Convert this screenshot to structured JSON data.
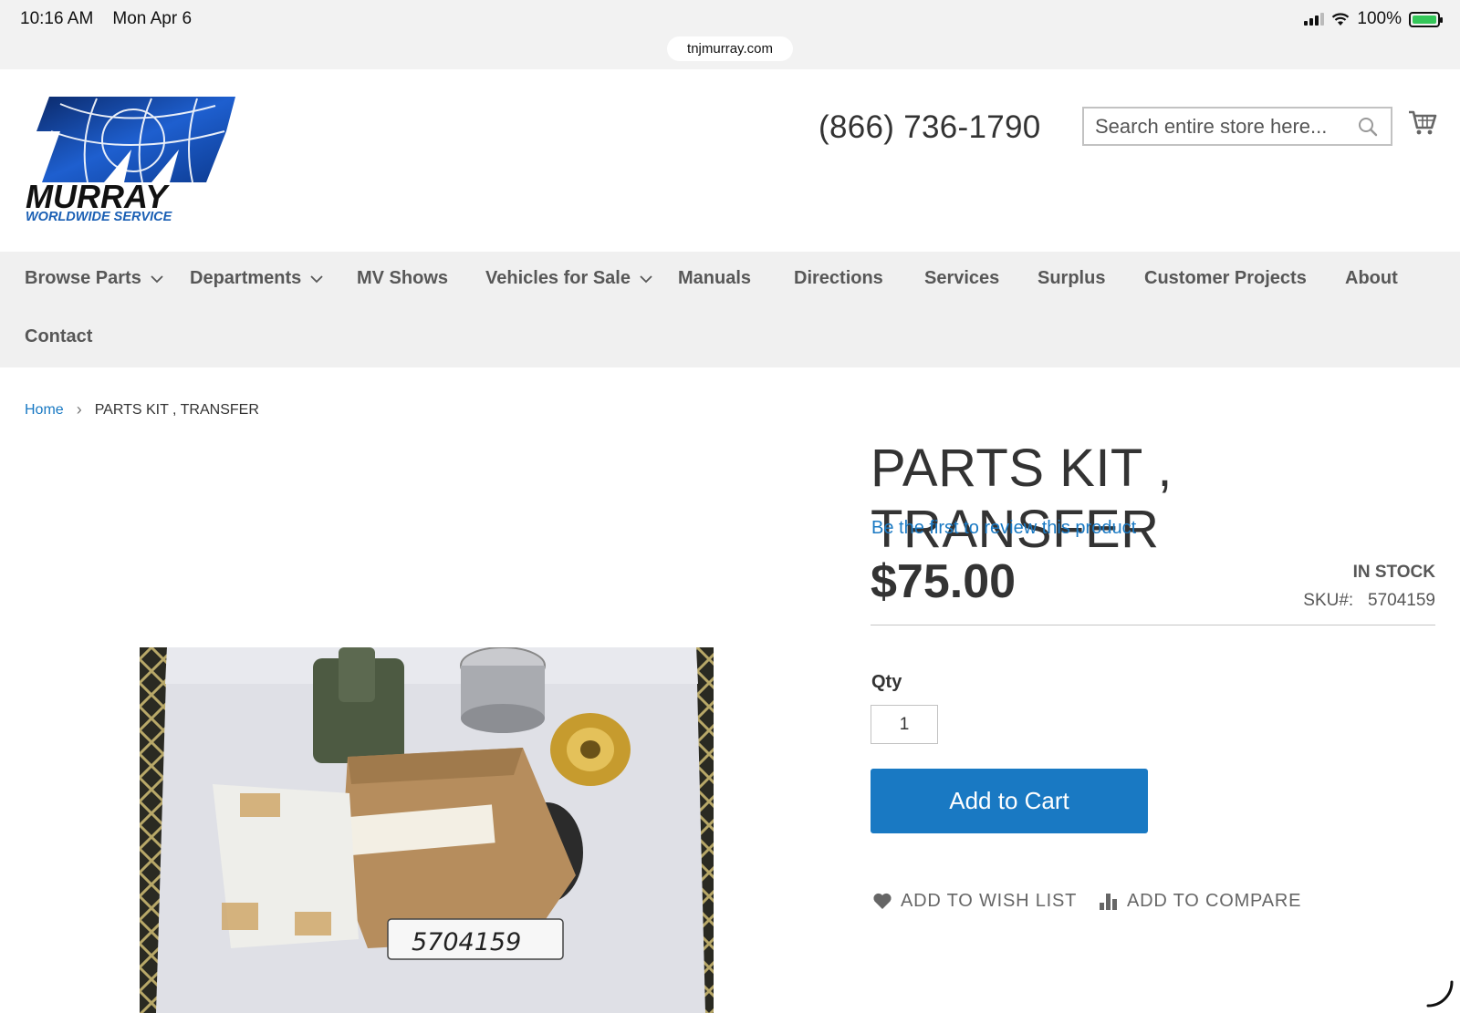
{
  "status_bar": {
    "time": "10:16 AM",
    "date": "Mon Apr 6",
    "battery": "100%"
  },
  "browser": {
    "url": "tnjmurray.com"
  },
  "header": {
    "logo_text": "MURRAY",
    "logo_subtext": "WORLDWIDE SERVICE",
    "phone": "(866) 736-1790",
    "search_placeholder": "Search entire store here..."
  },
  "nav": {
    "items": [
      {
        "label": "Browse Parts",
        "has_dropdown": true
      },
      {
        "label": "Departments",
        "has_dropdown": true
      },
      {
        "label": "MV Shows",
        "has_dropdown": false
      },
      {
        "label": "Vehicles for Sale",
        "has_dropdown": true
      },
      {
        "label": "Manuals",
        "has_dropdown": false
      },
      {
        "label": "Directions",
        "has_dropdown": false
      },
      {
        "label": "Services",
        "has_dropdown": false
      },
      {
        "label": "Surplus",
        "has_dropdown": false
      },
      {
        "label": "Customer Projects",
        "has_dropdown": false
      },
      {
        "label": "About",
        "has_dropdown": false
      },
      {
        "label": "Contact",
        "has_dropdown": false
      }
    ]
  },
  "breadcrumb": {
    "home": "Home",
    "separator": "›",
    "current": "PARTS KIT , TRANSFER"
  },
  "product": {
    "title": "PARTS KIT , TRANSFER",
    "review_link": "Be the first to review this product",
    "price": "$75.00",
    "stock": "IN STOCK",
    "sku_label": "SKU#:",
    "sku": "5704159",
    "qty_label": "Qty",
    "qty_value": "1",
    "add_to_cart": "Add to Cart",
    "wishlist": "ADD TO WISH LIST",
    "compare": "ADD TO COMPARE",
    "image_label": "5704159"
  },
  "colors": {
    "accent": "#1979c3",
    "nav_bg": "#f0f0f0",
    "text": "#333333",
    "logo_blue": "#1a5fb4"
  }
}
